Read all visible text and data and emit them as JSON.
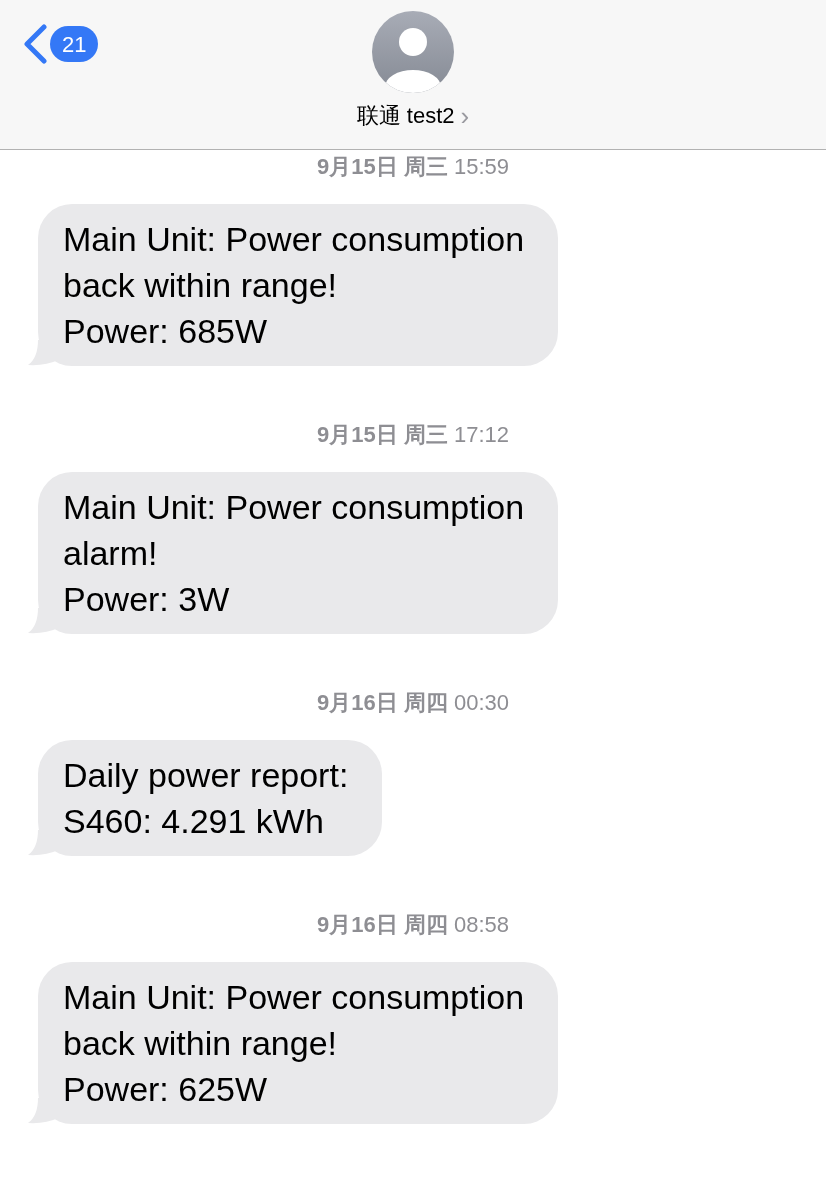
{
  "header": {
    "back_badge": "21",
    "contact": "联通 test2",
    "chevron": "›"
  },
  "messages": [
    {
      "date": "9月15日 周三",
      "time": "15:59",
      "lines": [
        "Main Unit: Power consumption",
        "back within range!",
        "Power: 685W"
      ]
    },
    {
      "date": "9月15日 周三",
      "time": "17:12",
      "lines": [
        "Main Unit: Power consumption",
        "alarm!",
        "Power: 3W"
      ]
    },
    {
      "date": "9月16日 周四",
      "time": "00:30",
      "lines": [
        "Daily power report:",
        "S460: 4.291 kWh"
      ]
    },
    {
      "date": "9月16日 周四",
      "time": "08:58",
      "lines": [
        "Main Unit: Power consumption",
        "back within range!",
        "Power: 625W"
      ]
    }
  ]
}
